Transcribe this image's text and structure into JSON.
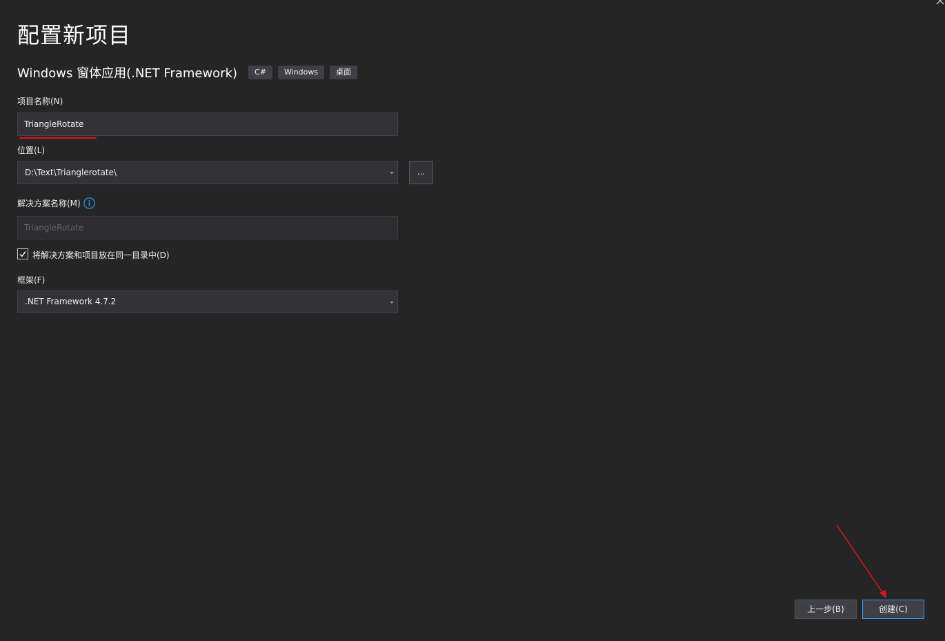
{
  "header": {
    "title": "配置新项目",
    "template_name": "Windows 窗体应用(.NET Framework)",
    "tags": [
      "C#",
      "Windows",
      "桌面"
    ]
  },
  "form": {
    "project_name": {
      "label": "项目名称(N)",
      "value": "TriangleRotate"
    },
    "location": {
      "label": "位置(L)",
      "value": "D:\\Text\\Trianglerotate\\",
      "browse_label": "..."
    },
    "solution_name": {
      "label": "解决方案名称(M)",
      "value": "TriangleRotate"
    },
    "same_directory": {
      "label": "将解决方案和项目放在同一目录中(D)",
      "checked": true
    },
    "framework": {
      "label": "框架(F)",
      "value": ".NET Framework 4.7.2"
    }
  },
  "footer": {
    "back_label": "上一步(B)",
    "create_label": "创建(C)"
  },
  "colors": {
    "background": "#252526",
    "annotation": "#e0141e",
    "accent_border": "#3399ff",
    "info_icon": "#1e8ad6"
  },
  "icons": [
    "close-icon",
    "info-icon",
    "dropdown-arrow-icon",
    "checkmark-icon"
  ]
}
